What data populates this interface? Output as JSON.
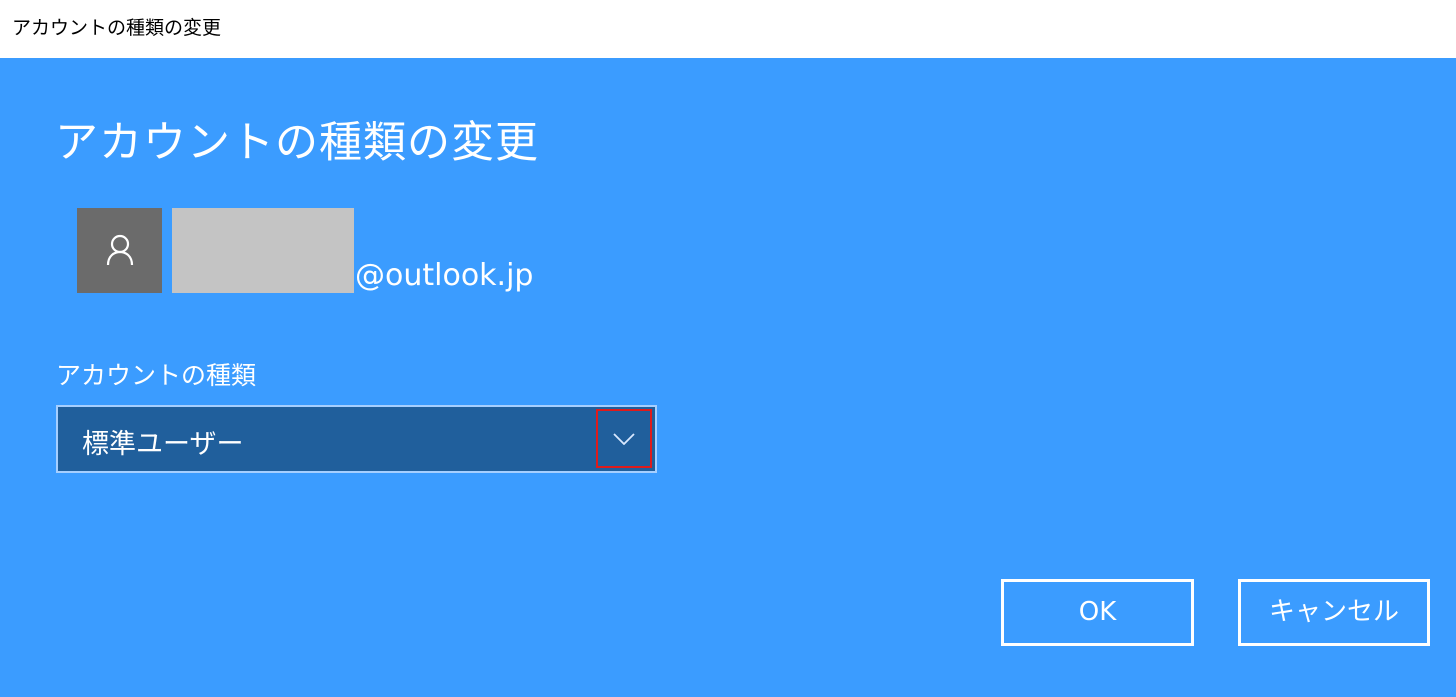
{
  "window": {
    "title": "アカウントの種類の変更"
  },
  "dialog": {
    "heading": "アカウントの種類の変更",
    "user": {
      "avatar_icon": "user-icon",
      "email_domain": "@outlook.jp"
    },
    "account_type": {
      "label": "アカウントの種類",
      "selected_value": "標準ユーザー",
      "dropdown_icon": "chevron-down-icon"
    },
    "buttons": {
      "ok_label": "OK",
      "cancel_label": "キャンセル"
    }
  },
  "colors": {
    "background": "#3b9cff",
    "titlebar": "#ffffff",
    "combo_background": "#205f9c",
    "combo_border": "#a6cfff",
    "highlight": "#e01b1b",
    "avatar": "#6b6b6b",
    "redacted": "#c4c4c4"
  }
}
